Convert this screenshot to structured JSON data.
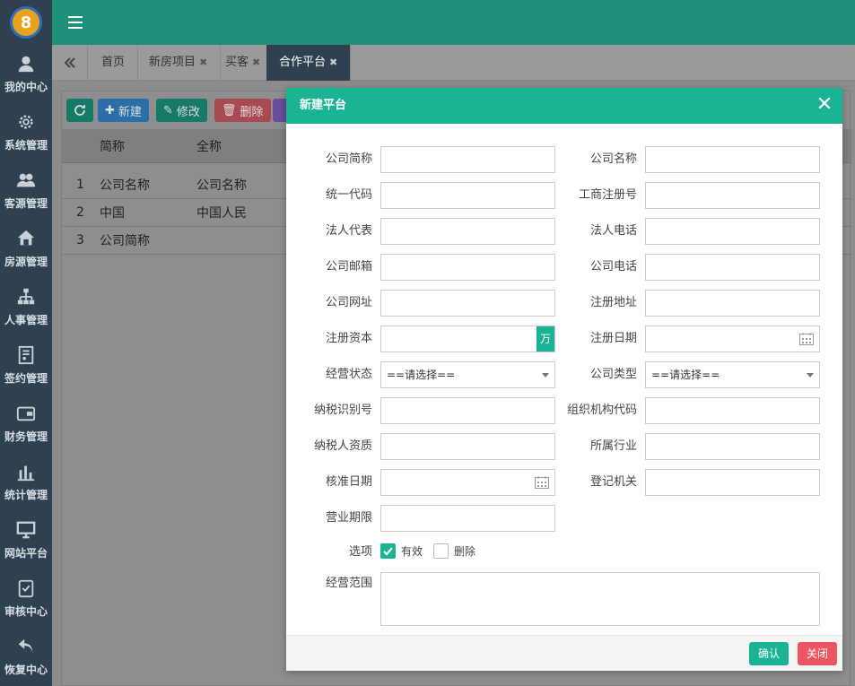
{
  "sidebar": {
    "logo_text": "8",
    "items": [
      {
        "label": "我的中心",
        "icon": "user-icon"
      },
      {
        "label": "系统管理",
        "icon": "gear-icon"
      },
      {
        "label": "客源管理",
        "icon": "users-icon"
      },
      {
        "label": "房源管理",
        "icon": "house-icon"
      },
      {
        "label": "人事管理",
        "icon": "org-chart-icon"
      },
      {
        "label": "签约管理",
        "icon": "contract-icon"
      },
      {
        "label": "财务管理",
        "icon": "wallet-icon"
      },
      {
        "label": "统计管理",
        "icon": "bar-chart-icon"
      },
      {
        "label": "网站平台",
        "icon": "monitor-icon"
      },
      {
        "label": "审核中心",
        "icon": "check-clipboard-icon"
      },
      {
        "label": "恢复中心",
        "icon": "undo-icon"
      }
    ]
  },
  "tabs": [
    {
      "label": "首页",
      "closable": false
    },
    {
      "label": "新房项目",
      "closable": true
    },
    {
      "label": "买客",
      "closable": true
    },
    {
      "label": "合作平台",
      "closable": true,
      "active": true
    }
  ],
  "toolbar": {
    "refresh_label": "",
    "new_label": "新建",
    "edit_label": "修改",
    "delete_label": "删除"
  },
  "grid": {
    "columns": [
      "简称",
      "全称"
    ],
    "rows": [
      {
        "num": "1",
        "short": "公司名称",
        "full": "公司名称"
      },
      {
        "num": "2",
        "short": "中国",
        "full": "中国人民"
      },
      {
        "num": "3",
        "short": "公司简称",
        "full": ""
      }
    ]
  },
  "modal": {
    "title": "新建平台",
    "fields": {
      "company_short": "公司简称",
      "company_name": "公司名称",
      "unified_code": "统一代码",
      "business_reg_no": "工商注册号",
      "legal_rep": "法人代表",
      "legal_phone": "法人电话",
      "company_email": "公司邮箱",
      "company_phone": "公司电话",
      "company_website": "公司网址",
      "reg_address": "注册地址",
      "reg_capital": "注册资本",
      "reg_capital_unit": "万",
      "reg_date": "注册日期",
      "operating_status": "经营状态",
      "company_type": "公司类型",
      "select_placeholder": "==请选择==",
      "taxpayer_id": "纳税识别号",
      "org_code": "组织机构代码",
      "taxpayer_qualification": "纳税人资质",
      "industry": "所属行业",
      "approval_date": "核准日期",
      "registration_authority": "登记机关",
      "business_term": "营业期限",
      "options_label": "选项",
      "option_valid": "有效",
      "option_deleted": "删除",
      "business_scope": "经营范围"
    },
    "options": {
      "valid_checked": true,
      "deleted_checked": false
    },
    "confirm_label": "确认",
    "close_label": "关闭"
  },
  "colors": {
    "accent": "#1ab394",
    "topbar": "#1f8f7a",
    "sidebar": "#2f4050",
    "danger": "#ed5565"
  }
}
